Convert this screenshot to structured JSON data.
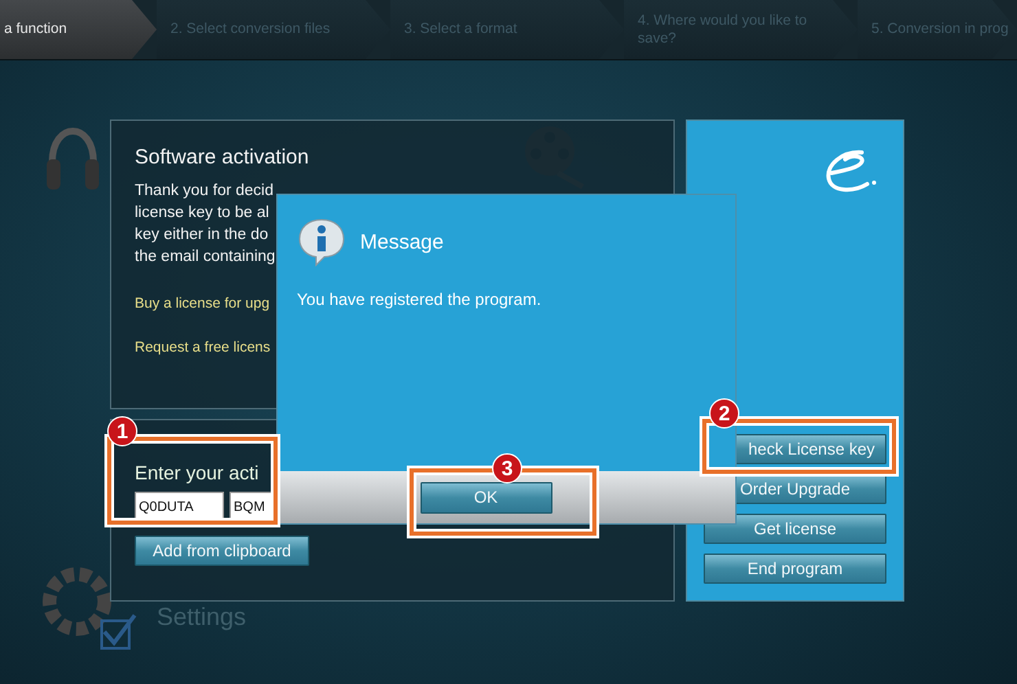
{
  "steps": [
    {
      "label": "a function",
      "selected": true
    },
    {
      "label": "2. Select conversion files",
      "selected": false
    },
    {
      "label": "3. Select a format",
      "selected": false
    },
    {
      "label": "4. Where would you like to save?",
      "selected": false
    },
    {
      "label": "5. Conversion in prog",
      "selected": false
    }
  ],
  "background_menu": [
    {
      "label": "Settings"
    }
  ],
  "activation": {
    "title": "Software activation",
    "description_lines": [
      "Thank you for decid",
      "license key to be al",
      "key either in the do",
      "the email containing"
    ],
    "links": [
      "Buy a license for upg",
      "Request a free licens"
    ],
    "key_prompt": "Enter your acti",
    "key_fields": [
      "Q0DUTA",
      "BQM"
    ],
    "clipboard_button": "Add from clipboard"
  },
  "side_panel": {
    "buttons": [
      "heck License key",
      "Order Upgrade",
      "Get license",
      "End program"
    ]
  },
  "dialog": {
    "title": "Message",
    "message": "You have registered the program.",
    "ok_button": "OK"
  },
  "callouts": [
    "1",
    "2",
    "3"
  ]
}
